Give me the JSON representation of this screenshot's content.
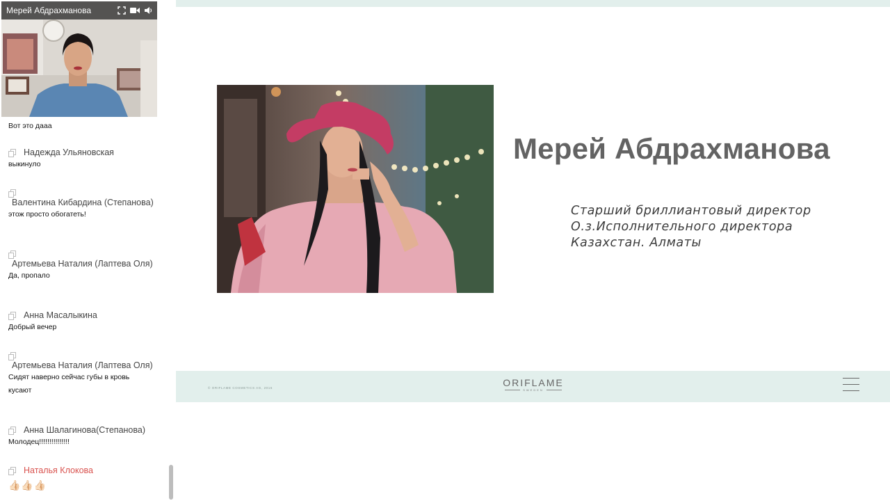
{
  "video": {
    "title": "Мерей Абдрахманова"
  },
  "chat": {
    "messages": [
      {
        "name": "",
        "text": "Вот это дааа"
      },
      {
        "name": "Надежда Ульяновская",
        "text": "выкинуло"
      },
      {
        "name": "Валентина Кибардина (Степанова)",
        "text": "этож просто обогатеть!"
      },
      {
        "name": "Артемьева Наталия (Лаптева Оля)",
        "text": "Да, пропало"
      },
      {
        "name": "Анна Масалыкина",
        "text": "Добрый вечер"
      },
      {
        "name": "Артемьева Наталия (Лаптева Оля)",
        "text": "Сидят наверно сейчас губы в кровь кусают"
      },
      {
        "name": "Анна Шалагинова(Степанова)",
        "text": "Молодец!!!!!!!!!!!!!!!"
      },
      {
        "name": "Наталья Клокова",
        "text": "👍🏻👍🏻👍🏻",
        "name_color": "#d9534f"
      }
    ]
  },
  "slide": {
    "title": "Мерей Абдрахманова",
    "subtitle_lines": [
      "Старший бриллиантовый директор",
      "О.з.Исполнительного директора",
      "Казахстан. Алматы"
    ],
    "footer": {
      "copyright": "© ORIFLAME COSMETICS AG, 2016",
      "logo": "ORIFLAME",
      "logo_sub": "SWEDEN"
    }
  },
  "colors": {
    "accent_mint": "#e2efec",
    "title_gray": "#636363",
    "highlight_name": "#d9534f"
  }
}
